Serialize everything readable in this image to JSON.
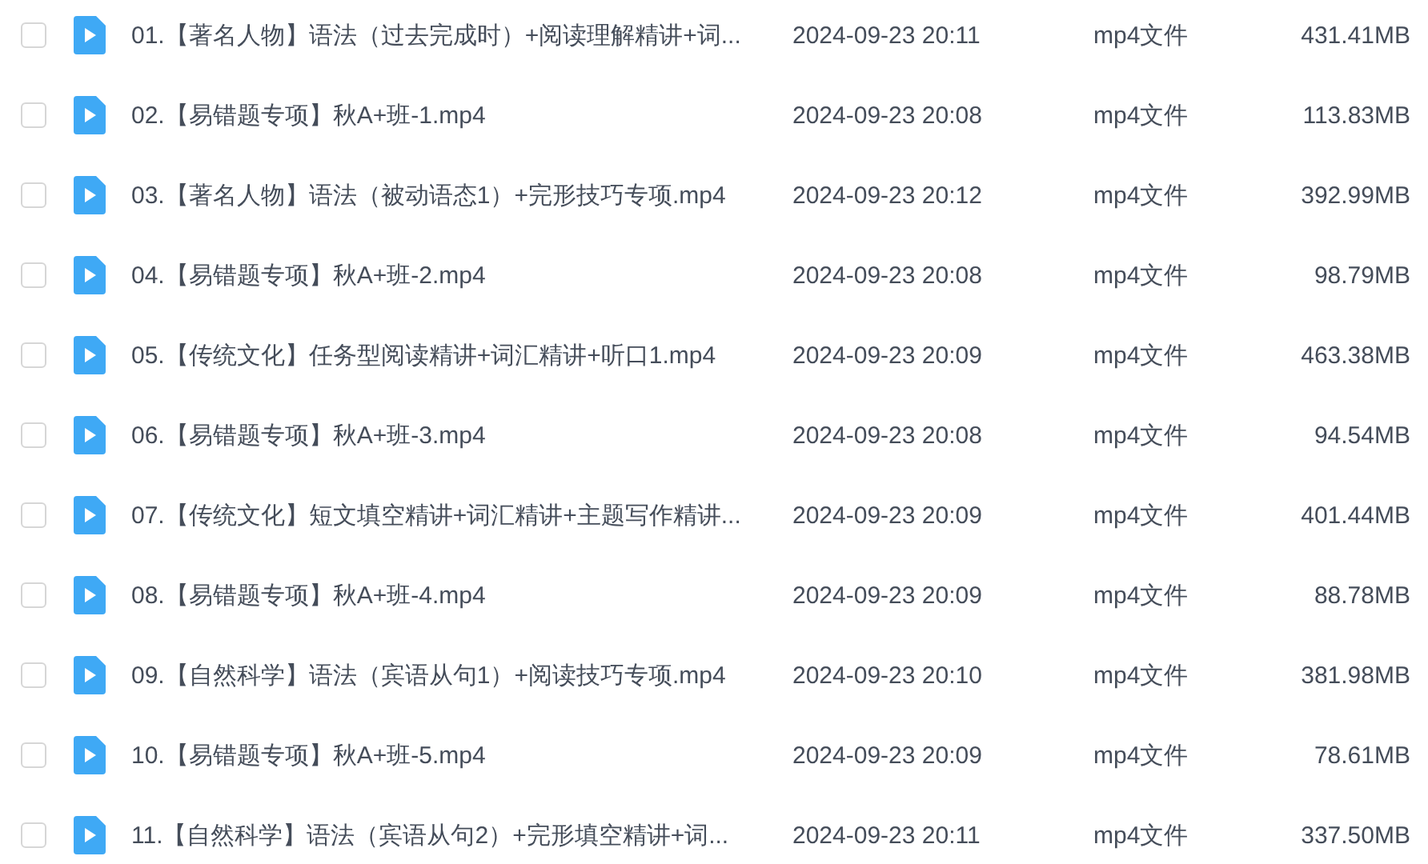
{
  "files": [
    {
      "checked": false,
      "name": "01.【著名人物】语法（过去完成时）+阅读理解精讲+词...",
      "date": "2024-09-23 20:11",
      "type": "mp4文件",
      "size": "431.41MB"
    },
    {
      "checked": false,
      "name": "02.【易错题专项】秋A+班-1.mp4",
      "date": "2024-09-23 20:08",
      "type": "mp4文件",
      "size": "113.83MB"
    },
    {
      "checked": false,
      "name": "03.【著名人物】语法（被动语态1）+完形技巧专项.mp4",
      "date": "2024-09-23 20:12",
      "type": "mp4文件",
      "size": "392.99MB"
    },
    {
      "checked": false,
      "name": "04.【易错题专项】秋A+班-2.mp4",
      "date": "2024-09-23 20:08",
      "type": "mp4文件",
      "size": "98.79MB"
    },
    {
      "checked": false,
      "name": "05.【传统文化】任务型阅读精讲+词汇精讲+听口1.mp4",
      "date": "2024-09-23 20:09",
      "type": "mp4文件",
      "size": "463.38MB"
    },
    {
      "checked": false,
      "name": "06.【易错题专项】秋A+班-3.mp4",
      "date": "2024-09-23 20:08",
      "type": "mp4文件",
      "size": "94.54MB"
    },
    {
      "checked": false,
      "name": "07.【传统文化】短文填空精讲+词汇精讲+主题写作精讲...",
      "date": "2024-09-23 20:09",
      "type": "mp4文件",
      "size": "401.44MB"
    },
    {
      "checked": false,
      "name": "08.【易错题专项】秋A+班-4.mp4",
      "date": "2024-09-23 20:09",
      "type": "mp4文件",
      "size": "88.78MB"
    },
    {
      "checked": false,
      "name": "09.【自然科学】语法（宾语从句1）+阅读技巧专项.mp4",
      "date": "2024-09-23 20:10",
      "type": "mp4文件",
      "size": "381.98MB"
    },
    {
      "checked": false,
      "name": "10.【易错题专项】秋A+班-5.mp4",
      "date": "2024-09-23 20:09",
      "type": "mp4文件",
      "size": "78.61MB"
    },
    {
      "checked": false,
      "name": "11.【自然科学】语法（宾语从句2）+完形填空精讲+词...",
      "date": "2024-09-23 20:11",
      "type": "mp4文件",
      "size": "337.50MB"
    }
  ]
}
